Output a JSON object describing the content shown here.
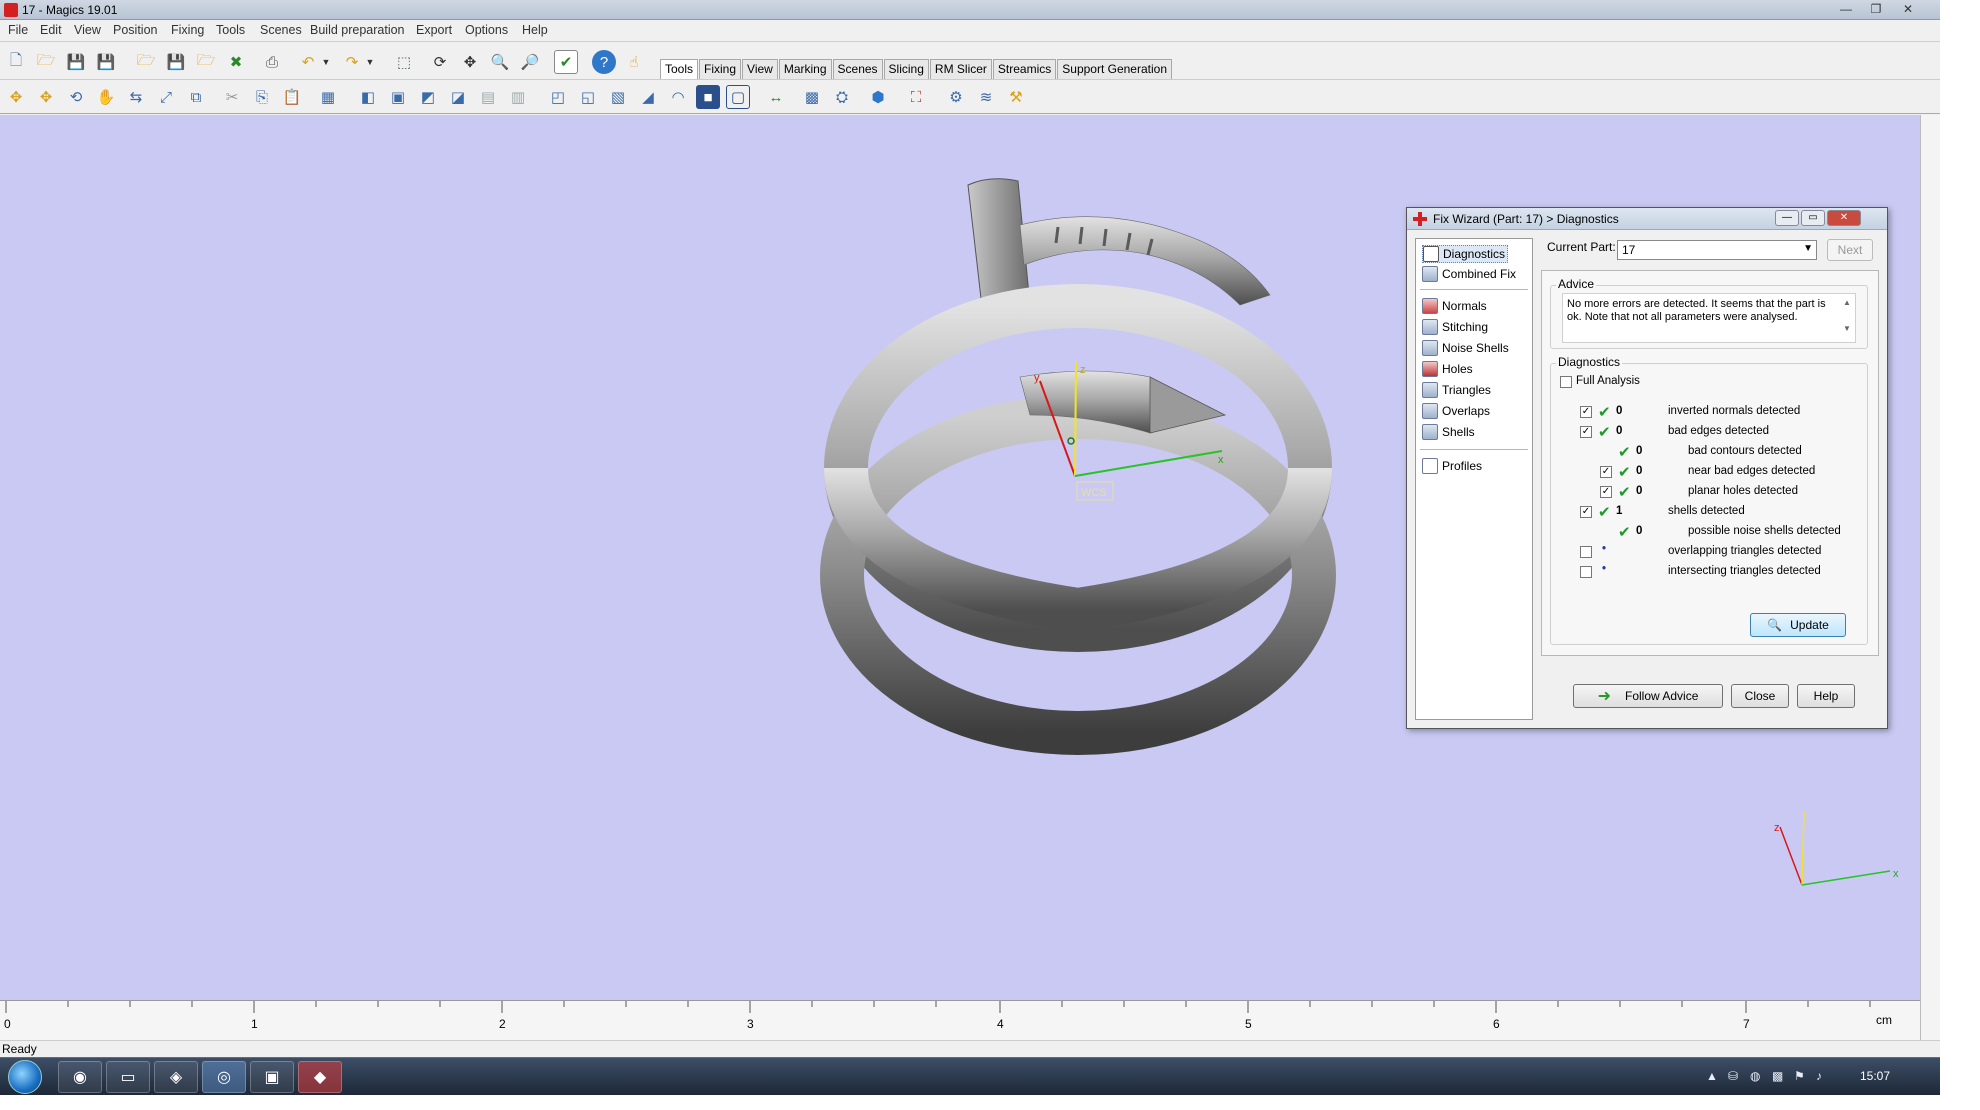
{
  "window": {
    "title": "17 - Magics 19.01",
    "controls": [
      "—",
      "❐",
      "✕"
    ]
  },
  "menubar": [
    "File",
    "Edit",
    "View",
    "Position",
    "Fixing",
    "Tools",
    "Scenes",
    "Build preparation",
    "Export",
    "Options",
    "Help"
  ],
  "toolbar": {
    "tabs": [
      "Tools",
      "Fixing",
      "View",
      "Marking",
      "Scenes",
      "Slicing",
      "RM Slicer",
      "Streamics",
      "Support Generation"
    ],
    "active_tab": "Tools"
  },
  "viewport": {
    "background": "#c9c9f4",
    "wcs_label": "WCS",
    "axes": {
      "x": "x",
      "y": "y",
      "z": "z"
    }
  },
  "ruler": {
    "labels": [
      "0",
      "1",
      "2",
      "3",
      "4",
      "5",
      "6",
      "7"
    ],
    "unit": "cm"
  },
  "status": {
    "text": "Ready"
  },
  "taskbar": {
    "clock": "15:07"
  },
  "dialog": {
    "title": "Fix Wizard (Part: 17) > Diagnostics",
    "nav_top": [
      "Diagnostics",
      "Combined Fix"
    ],
    "nav_mid": [
      "Normals",
      "Stitching",
      "Noise Shells",
      "Holes",
      "Triangles",
      "Overlaps",
      "Shells"
    ],
    "nav_bottom": [
      "Profiles"
    ],
    "selected_nav": "Diagnostics",
    "current_part_label": "Current Part:",
    "current_part_value": "17",
    "next_label": "Next",
    "advice_heading": "Advice",
    "advice_text": "No more errors are detected. It seems that the part is ok. Note that not all parameters were analysed.",
    "diagnostics_heading": "Diagnostics",
    "full_analysis_label": "Full Analysis",
    "full_analysis_checked": false,
    "rows": [
      {
        "checkbox": true,
        "checked": true,
        "status": "ok",
        "count": "0",
        "label": "inverted normals detected",
        "indent": 0
      },
      {
        "checkbox": true,
        "checked": true,
        "status": "ok",
        "count": "0",
        "label": "bad edges detected",
        "indent": 0
      },
      {
        "checkbox": false,
        "checked": false,
        "status": "ok",
        "count": "0",
        "label": "bad contours detected",
        "indent": 1
      },
      {
        "checkbox": true,
        "checked": true,
        "status": "ok",
        "count": "0",
        "label": "near bad edges detected",
        "indent": 1
      },
      {
        "checkbox": true,
        "checked": true,
        "status": "ok",
        "count": "0",
        "label": "planar holes detected",
        "indent": 1
      },
      {
        "checkbox": true,
        "checked": true,
        "status": "ok",
        "count": "1",
        "label": "shells detected",
        "indent": 0
      },
      {
        "checkbox": false,
        "checked": false,
        "status": "ok",
        "count": "0",
        "label": "possible noise shells detected",
        "indent": 1
      },
      {
        "checkbox": true,
        "checked": false,
        "status": "dot",
        "count": "",
        "label": "overlapping triangles detected",
        "indent": 0
      },
      {
        "checkbox": true,
        "checked": false,
        "status": "dot",
        "count": "",
        "label": "intersecting triangles detected",
        "indent": 0
      }
    ],
    "update_label": "Update",
    "follow_advice_label": "Follow Advice",
    "close_label": "Close",
    "help_label": "Help"
  }
}
